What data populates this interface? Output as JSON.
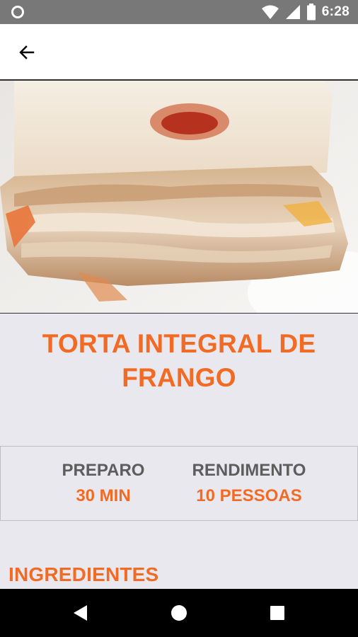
{
  "status_bar": {
    "time": "6:28"
  },
  "recipe": {
    "title_line1": "TORTA INTEGRAL DE",
    "title_line2": "FRANGO",
    "preparo_label": "PREPARO",
    "preparo_value": "30 MIN",
    "rendimento_label": "RENDIMENTO",
    "rendimento_value": "10 PESSOAS",
    "ingredients_heading": "INGREDIENTES"
  },
  "colors": {
    "accent": "#f26b25",
    "label_gray": "#5d5d5d",
    "background": "#e9e8ee"
  },
  "icons": {
    "app_bar": "arrow-left-icon",
    "status_left": "circle-indicator-icon",
    "status_right": [
      "wifi-icon",
      "signal-icon",
      "battery-icon"
    ],
    "nav": [
      "nav-back-icon",
      "nav-home-icon",
      "nav-recents-icon"
    ]
  }
}
